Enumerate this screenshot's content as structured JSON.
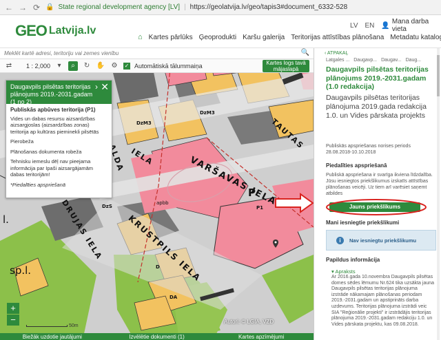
{
  "browser": {
    "secure_label": "State regional development agency [LV]",
    "url": "https://geolatvija.lv/geo/tapis3#document_6332-528"
  },
  "header": {
    "logo_geo": "GEO",
    "logo_rest": "Latvija.lv",
    "lang_lv": "LV",
    "lang_en": "EN",
    "workspace": "Mana darba vieta",
    "nav": [
      "Kartes pārlūks",
      "Ģeoprodukti",
      "Karšu galerija",
      "Teritorijas attīstības plānošana",
      "Metadatu katalogs"
    ]
  },
  "map": {
    "search_placeholder": "Meklēt kartē adresi, teritoriju vai zemes vienību",
    "scale": "1 : 2,000",
    "auto_zoom_label": "Automātiskā tālummaiņa",
    "print_button": "Kartes logs tavā mājaslapā",
    "zoom_in": "+",
    "zoom_out": "−",
    "scale_label": "50m",
    "attribution": "Autori: © LGIA, VZD",
    "streets": {
      "varsavas": "VARŠAVAS  IELA",
      "krustpils": "KRUSTPILS  IELA",
      "drujas": "DRUJAS  IELA",
      "tautas": "TAUTAS",
      "alda": "ALDA",
      "iela_left": "IELA"
    },
    "map_labels": {
      "p": "P",
      "spl": "sp.l.",
      "l": "l.",
      "dzm3": "DzM3",
      "dzm3b": "DzM3",
      "dzs": "DzS",
      "p1": "P1",
      "da": "DA",
      "d": "D",
      "apbb": "apbb"
    }
  },
  "popup": {
    "title": "Daugavpils pilsētas teritorijas plānojums 2019.-2031.gadam (1 no 2)",
    "zone_title": "Publiskās apbūves teritorija (P1)",
    "lines": [
      "Vides un dabas resursu aizsardzības aizsargjoslas (aizsardzības zonas) teritorija ap kultūras pieminekli pilsētās",
      "Pierobeža",
      "Plānošanas dokumenta robeža",
      "Tehnisku iemeslu dēļ nav pieejama informācija par Ipaši aizsargājamām dabas teritorijām!"
    ],
    "note": "*Piedalīties apspriešanā"
  },
  "bottombar": {
    "left": "Biežāk uzdotie jautājumi",
    "mid": "Izvēlētie dokumenti (1)",
    "right": "Kartes apzīmējumi"
  },
  "panel": {
    "back": "ATPAKAĻ",
    "crumbs": [
      "Latgales ...",
      "Daugavp...",
      "Daugav...",
      "Daug..."
    ],
    "title": "Daugavpils pilsētas teritorijas plānojums 2019.-2031.gadam (1.0 redakcija)",
    "desc": "Daugavpils pilsētas teritorijas plānojuma 2019.gada redakcija 1.0. un Vides pārskata projekts",
    "dates_label": "Publiskās apspriešanas norises periods",
    "dates": "28.08.2018-10.10.2018",
    "participate_heading": "Piedalīties apspriešanā",
    "participate_text": "Publiskā apspriešana ir svarīga ikviena līdzdalība. Jūsu iesniegtos priekšlikumus izskatīs attīstības plānošanas veicēji. Uz tiem arī varēsiet saņemt atbildes",
    "new_button": "Jauns priekšlikums",
    "my_heading": "Mani iesniegtie priekšlikumi",
    "none_text": "Nav iesniegtu priekšlikumu",
    "extra_heading": "Papildus informācija",
    "apraksts": "Apraksts",
    "apraksts_text": "Ar 2016.gada 10.novembra Daugavpils pilsētas domes sēdes lēmumu Nr.624 tika uzsākta jauna Daugavpils pilsētas teritorijas plānojuma izstrāde nākamajam plānošanas periodam 2019.-2031.gadam un apstiprināts darba uzdevums. Teritorijas plānojuma izstrādi veic SIA \"Reģionālie projekti\" ir izstrādājis teritorijas plānojuma 2019.-2031.gadam redakciju 1.0. un Vides pārskata projektu, kas 09.08.2018."
  },
  "colors": {
    "accent": "#2e8a3c",
    "map_pink": "#f28b9c",
    "map_yellow": "#f2c260",
    "annotation_red": "#d9231f"
  }
}
